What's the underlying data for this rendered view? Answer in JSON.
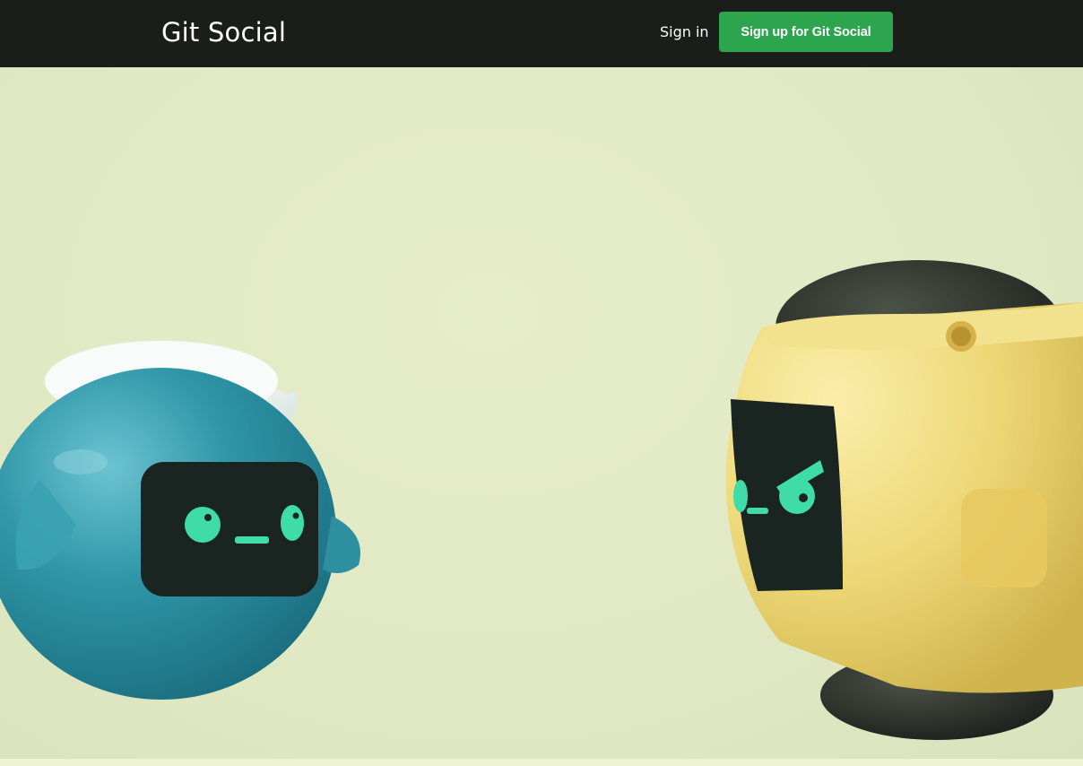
{
  "header": {
    "brand": "Git Social",
    "sign_in_label": "Sign in",
    "sign_up_label": "Sign up for Git Social"
  },
  "colors": {
    "header_bg": "#1b1d1b",
    "accent_green": "#2da44e",
    "hero_bg": "#e2eac5",
    "blue_robot": "#2e93a5",
    "yellow_robot": "#ecd775",
    "screen_face": "#1a2420",
    "eye_mint": "#3fdca8"
  },
  "hero": {
    "illustration": "two-robot-mascots"
  }
}
